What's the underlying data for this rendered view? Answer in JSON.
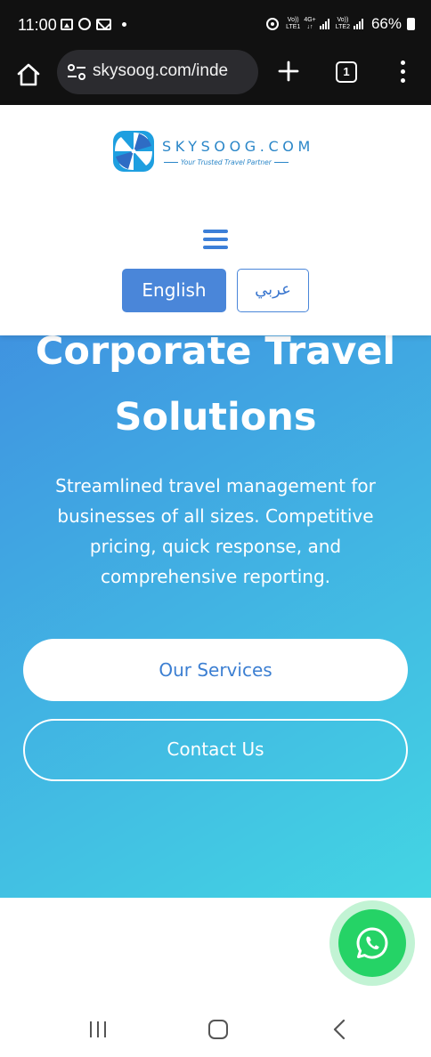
{
  "status_bar": {
    "time": "11:00",
    "sim1_top": "Vo))",
    "sim1_bottom": "LTE1",
    "net_top": "4G+",
    "net_bottom": "↓↑",
    "sim2_top": "Vo))",
    "sim2_bottom": "LTE2",
    "battery": "66%"
  },
  "browser": {
    "url": "skysoog.com/inde",
    "tab_count": "1"
  },
  "header": {
    "brand": "SKYSOOG.COM",
    "tagline": "Your Trusted Travel Partner",
    "lang_english": "English",
    "lang_arabic": "عربي"
  },
  "hero": {
    "title_line1": "Corporate Travel",
    "title_line2": "Solutions",
    "description": "Streamlined travel management for businesses of all sizes. Competitive pricing, quick response, and comprehensive reporting.",
    "primary_button": "Our Services",
    "secondary_button": "Contact Us"
  },
  "colors": {
    "brand_blue": "#4a86d9",
    "hero_gradient_start": "#3f8fe0",
    "hero_gradient_end": "#43d5e3",
    "whatsapp_green": "#25d366"
  },
  "icons": [
    "home-icon",
    "site-settings-icon",
    "plus-icon",
    "tabs-icon",
    "more-vert-icon",
    "hamburger-icon",
    "whatsapp-icon",
    "recent-apps-icon",
    "home-nav-icon",
    "back-icon"
  ]
}
